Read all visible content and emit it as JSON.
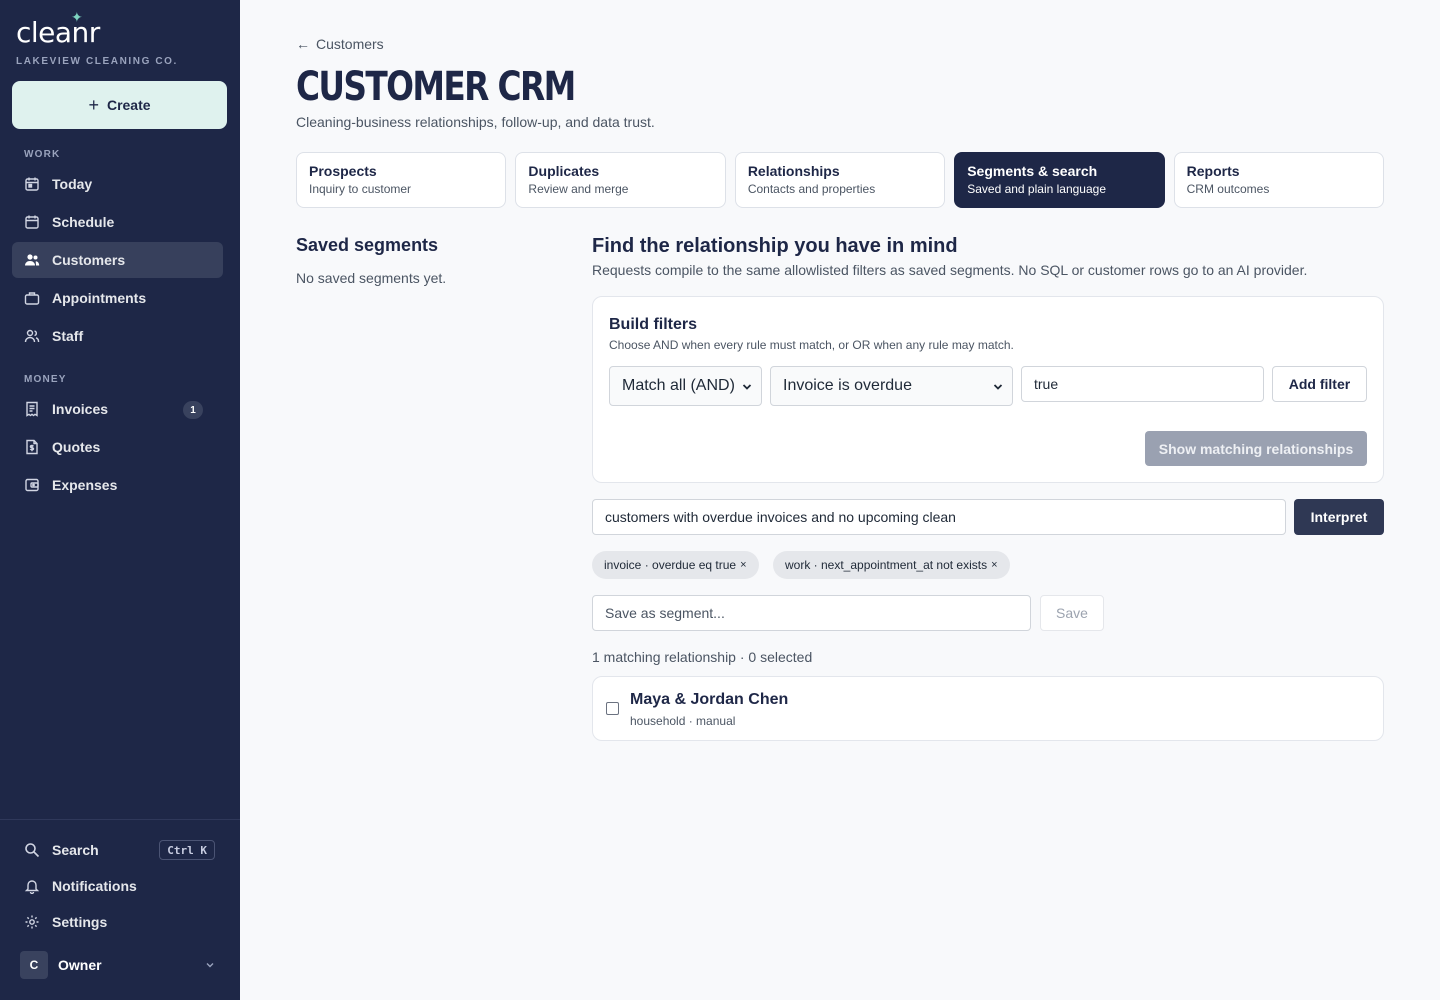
{
  "brand": {
    "logo": "cleanr",
    "org": "LAKEVIEW CLEANING CO."
  },
  "sidebar": {
    "create_label": "Create",
    "work_label": "WORK",
    "money_label": "MONEY",
    "work_items": [
      {
        "label": "Today",
        "icon": "calendar-day-icon"
      },
      {
        "label": "Schedule",
        "icon": "calendar-icon"
      },
      {
        "label": "Customers",
        "icon": "users-icon",
        "active": true
      },
      {
        "label": "Appointments",
        "icon": "briefcase-icon"
      },
      {
        "label": "Staff",
        "icon": "staff-icon"
      }
    ],
    "money_items": [
      {
        "label": "Invoices",
        "icon": "receipt-icon",
        "badge": "1"
      },
      {
        "label": "Quotes",
        "icon": "document-dollar-icon"
      },
      {
        "label": "Expenses",
        "icon": "wallet-icon"
      }
    ],
    "bottom_items": [
      {
        "label": "Search",
        "icon": "search-icon",
        "shortcut": "Ctrl K"
      },
      {
        "label": "Notifications",
        "icon": "bell-icon"
      },
      {
        "label": "Settings",
        "icon": "gear-icon"
      }
    ],
    "user": {
      "initial": "C",
      "name": "Owner"
    }
  },
  "header": {
    "back_label": "Customers",
    "title": "CUSTOMER CRM",
    "subtitle": "Cleaning-business relationships, follow-up, and data trust."
  },
  "tabs": [
    {
      "title": "Prospects",
      "sub": "Inquiry to customer"
    },
    {
      "title": "Duplicates",
      "sub": "Review and merge"
    },
    {
      "title": "Relationships",
      "sub": "Contacts and properties"
    },
    {
      "title": "Segments & search",
      "sub": "Saved and plain language",
      "active": true
    },
    {
      "title": "Reports",
      "sub": "CRM outcomes"
    }
  ],
  "segments": {
    "title": "Saved segments",
    "empty": "No saved segments yet."
  },
  "finder": {
    "title": "Find the relationship you have in mind",
    "subtitle": "Requests compile to the same allowlisted filters as saved segments. No SQL or customer rows go to an AI provider.",
    "build_title": "Build filters",
    "build_sub": "Choose AND when every rule must match, or OR when any rule may match.",
    "match_select": "Match all (AND)",
    "field_select": "Invoice is overdue",
    "value_input": "true",
    "add_filter_label": "Add filter",
    "show_matching_label": "Show matching relationships",
    "query_value": "customers with overdue invoices and no upcoming clean",
    "interpret_label": "Interpret",
    "chips": [
      "invoice · overdue eq true",
      "work · next_appointment_at not exists"
    ],
    "chip_remove": "×",
    "save_placeholder": "Save as segment...",
    "save_label": "Save",
    "count_line": "1 matching relationship · 0 selected"
  },
  "results": [
    {
      "name": "Maya & Jordan Chen",
      "meta": "household · manual"
    }
  ]
}
